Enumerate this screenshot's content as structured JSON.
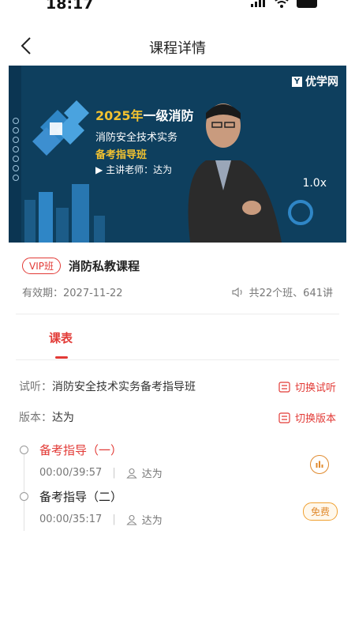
{
  "status": {
    "time": "18:17"
  },
  "nav": {
    "title": "课程详情"
  },
  "video": {
    "brand": "优学网",
    "title_year": "2025年",
    "title_rest": "一级消防",
    "subtitle": "消防安全技术实务",
    "subtitle2": "备考指导班",
    "teacher": "主讲老师：达为",
    "speed": "1.0x"
  },
  "course": {
    "badge": "VIP班",
    "name": "消防私教课程",
    "validity": "有效期：2027-11-22",
    "stats": "共22个班、641讲"
  },
  "tabs": [
    {
      "label": "课表"
    }
  ],
  "trial": {
    "label": "试听：",
    "value": "消防安全技术实务备考指导班",
    "action": "切换试听"
  },
  "version": {
    "label": "版本：",
    "value": "达为",
    "action": "切换版本"
  },
  "lessons": [
    {
      "title": "备考指导（一）",
      "time": "00:00/39:57",
      "teacher": "达为",
      "status": "playing"
    },
    {
      "title": "备考指导（二）",
      "time": "00:00/35:17",
      "teacher": "达为",
      "badge": "免费"
    }
  ]
}
